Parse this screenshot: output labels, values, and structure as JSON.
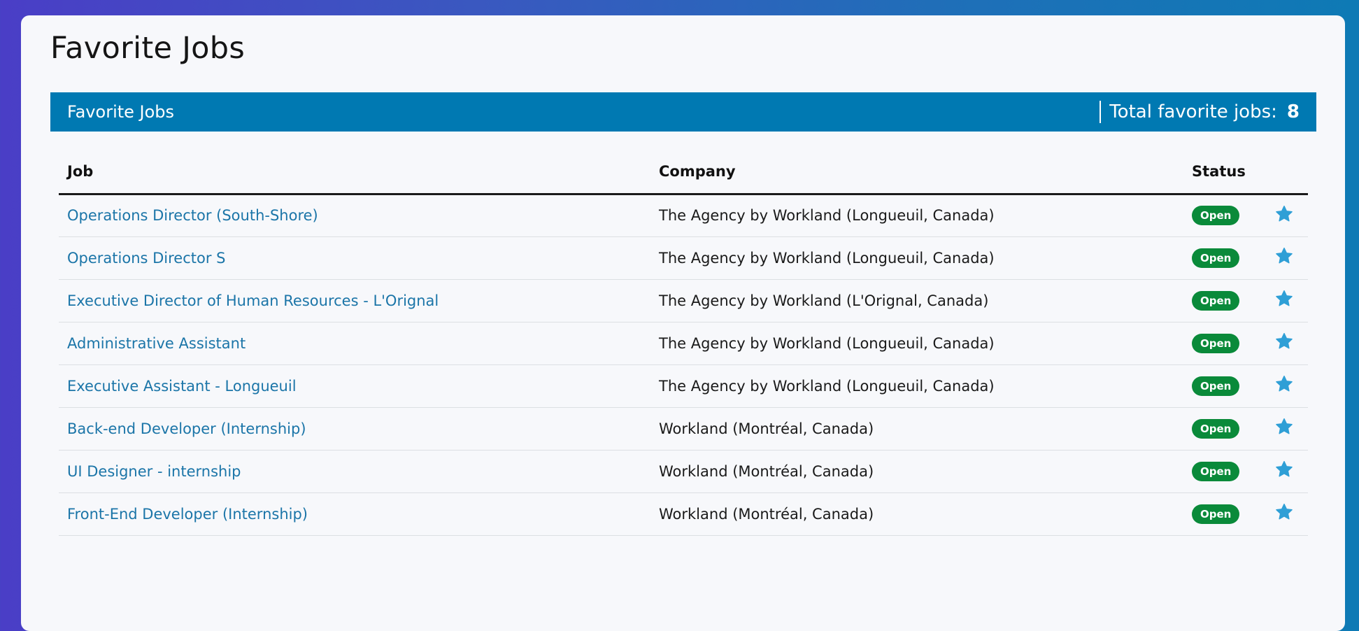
{
  "page": {
    "title": "Favorite Jobs"
  },
  "panel": {
    "title": "Favorite Jobs",
    "total_label": "Total favorite jobs:",
    "total_count": "8"
  },
  "table": {
    "headers": {
      "job": "Job",
      "company": "Company",
      "status": "Status"
    },
    "rows": [
      {
        "job": "Operations Director (South-Shore)",
        "company": "The Agency by Workland (Longueuil, Canada)",
        "status": "Open",
        "favorite_icon": "star-icon"
      },
      {
        "job": "Operations Director S",
        "company": "The Agency by Workland (Longueuil, Canada)",
        "status": "Open",
        "favorite_icon": "star-icon"
      },
      {
        "job": "Executive Director of Human Resources - L'Orignal",
        "company": "The Agency by Workland (L'Orignal, Canada)",
        "status": "Open",
        "favorite_icon": "star-icon"
      },
      {
        "job": "Administrative Assistant",
        "company": "The Agency by Workland (Longueuil, Canada)",
        "status": "Open",
        "favorite_icon": "star-icon"
      },
      {
        "job": "Executive Assistant - Longueuil",
        "company": "The Agency by Workland (Longueuil, Canada)",
        "status": "Open",
        "favorite_icon": "star-icon"
      },
      {
        "job": "Back-end Developer (Internship)",
        "company": "Workland (Montréal, Canada)",
        "status": "Open",
        "favorite_icon": "star-icon"
      },
      {
        "job": "UI Designer - internship",
        "company": "Workland (Montréal, Canada)",
        "status": "Open",
        "favorite_icon": "star-icon"
      },
      {
        "job": "Front-End Developer (Internship)",
        "company": "Workland (Montréal, Canada)",
        "status": "Open",
        "favorite_icon": "star-icon"
      }
    ]
  },
  "colors": {
    "header_bg": "#0079b2",
    "link": "#1b75a8",
    "badge_open": "#0a8a3a",
    "star": "#2f9fd6"
  }
}
